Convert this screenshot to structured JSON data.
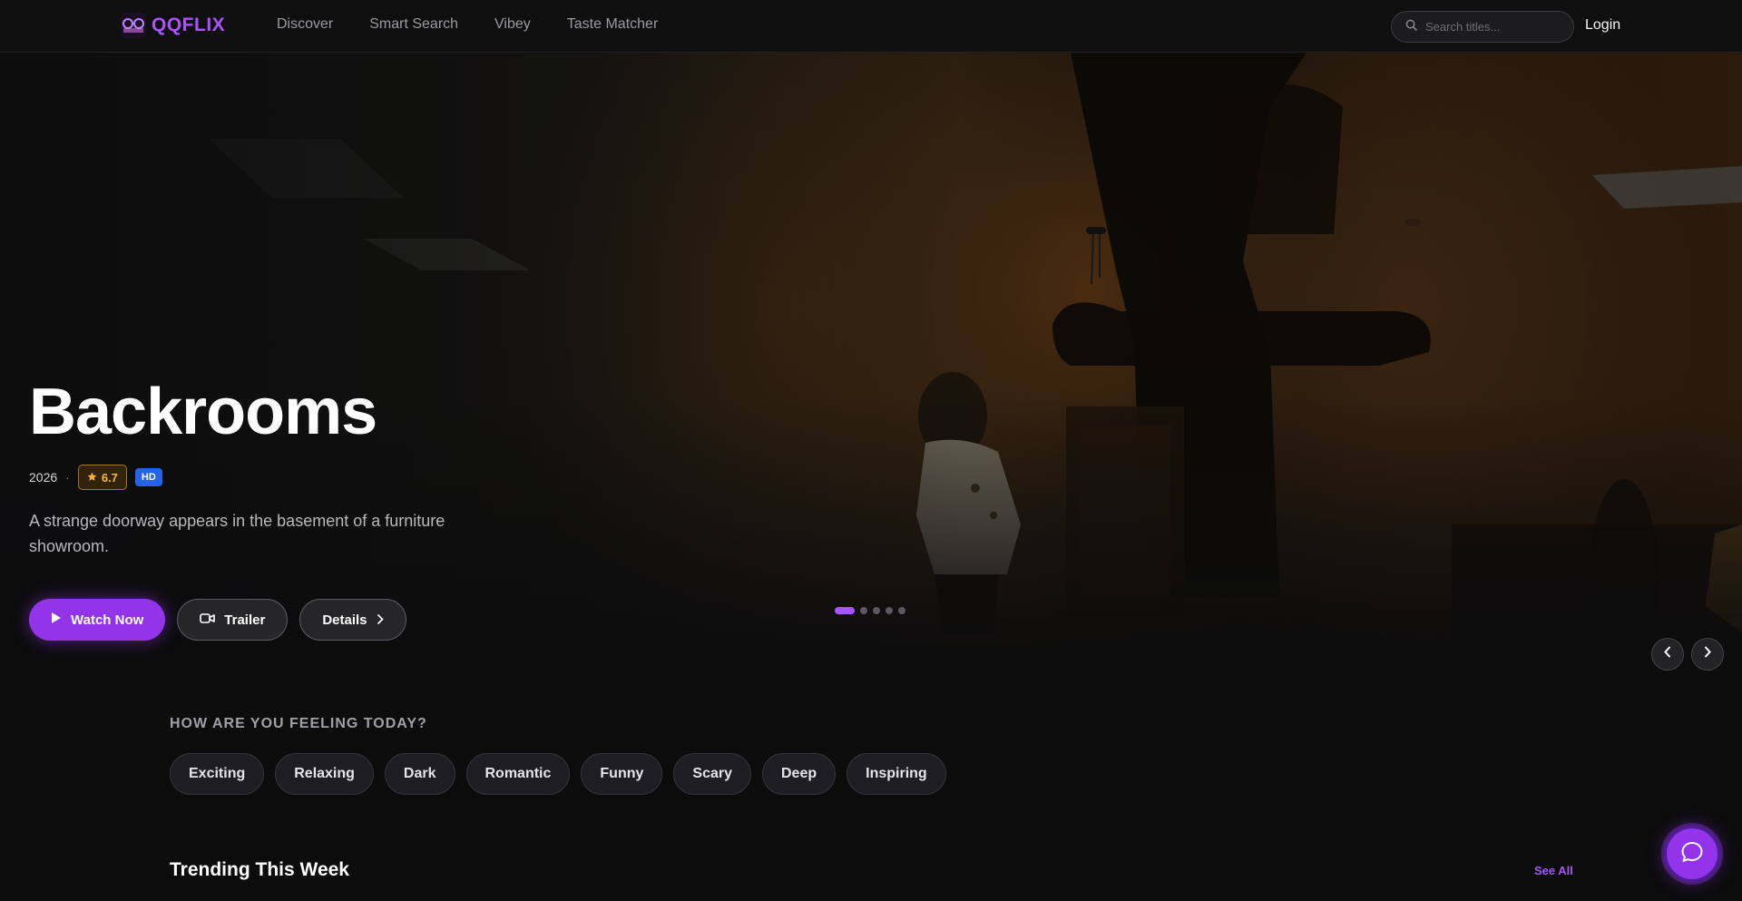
{
  "brand": {
    "name": "QQFLIX",
    "accent": "#a855f7"
  },
  "nav": {
    "links": [
      "Discover",
      "Smart Search",
      "Vibey",
      "Taste Matcher"
    ],
    "search_placeholder": "Search titles...",
    "login": "Login"
  },
  "hero": {
    "title": "Backrooms",
    "year": "2026",
    "rating": "6.7",
    "quality": "HD",
    "description": "A strange doorway appears in the basement of a furniture showroom.",
    "buttons": {
      "watch": "Watch Now",
      "trailer": "Trailer",
      "details": "Details"
    },
    "slides_total": 5,
    "slide_active": 1,
    "icons": [
      "play-icon",
      "video-camera-icon",
      "chevron-right-icon",
      "chevron-left-icon"
    ]
  },
  "moods": {
    "heading": "HOW ARE YOU FEELING TODAY?",
    "items": [
      "Exciting",
      "Relaxing",
      "Dark",
      "Romantic",
      "Funny",
      "Scary",
      "Deep",
      "Inspiring"
    ]
  },
  "trending": {
    "title": "Trending This Week",
    "see_all": "See All"
  },
  "colors": {
    "primary": "#9333ea",
    "rating_gold": "#f6b62a",
    "hd_blue": "#2563eb"
  }
}
